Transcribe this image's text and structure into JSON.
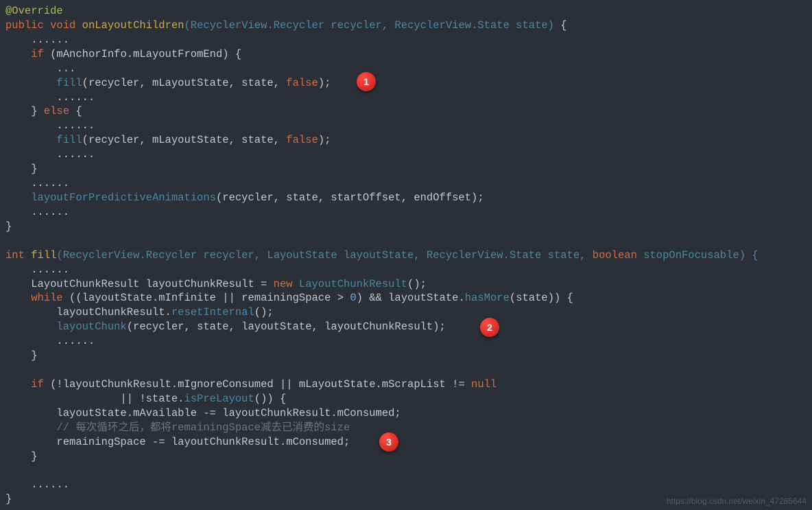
{
  "code": {
    "block1": {
      "l1_annotation": "@Override",
      "l2_kw_public": "public",
      "l2_kw_void": "void",
      "l2_method": "onLayoutChildren",
      "l2_sig_a": "(RecyclerView.Recycler recycler, RecyclerView.State state)",
      "l2_brace": " {",
      "l3_dots": "    ......",
      "l4_if_kw": "if",
      "l4_if_cond": " (mAnchorInfo.mLayoutFromEnd) {",
      "l5_dots": "        ...",
      "l6_indent": "        ",
      "l6_call": "fill",
      "l6_args_a": "(recycler, mLayoutState, state, ",
      "l6_false": "false",
      "l6_args_b": ");",
      "l7_dots": "        ......",
      "l8_else_a": "    } ",
      "l8_else_kw": "else",
      "l8_else_b": " {",
      "l9_dots": "        ......",
      "l10_indent": "        ",
      "l10_call": "fill",
      "l10_args_a": "(recycler, mLayoutState, state, ",
      "l10_false": "false",
      "l10_args_b": ");",
      "l11_dots": "        ......",
      "l12_close": "    }",
      "l13_dots": "    ......",
      "l14_indent": "    ",
      "l14_call": "layoutForPredictiveAnimations",
      "l14_args": "(recycler, state, startOffset, endOffset);",
      "l15_dots": "    ......",
      "l16_close": "}"
    },
    "block2": {
      "l1_kw_int": "int",
      "l1_method": "fill",
      "l1_sig_a": "(RecyclerView.Recycler recycler, LayoutState layoutState, RecyclerView.State state, ",
      "l1_bool": "boolean",
      "l1_sig_b": " stopOnFocusable) {",
      "l2_dots": "    ......",
      "l3_a": "    LayoutChunkResult layoutChunkResult = ",
      "l3_new": "new",
      "l3_b": " ",
      "l3_ctor": "LayoutChunkResult",
      "l3_c": "();",
      "l4_indent": "    ",
      "l4_while": "while",
      "l4_cond_a": " ((layoutState.mInfinite || remainingSpace > ",
      "l4_zero": "0",
      "l4_cond_b": ") && layoutState.",
      "l4_hasMore": "hasMore",
      "l4_cond_c": "(state)) {",
      "l5_a": "        layoutChunkResult.",
      "l5_reset": "resetInternal",
      "l5_b": "();",
      "l6_indent": "        ",
      "l6_call": "layoutChunk",
      "l6_args": "(recycler, state, layoutState, layoutChunkResult);",
      "l7_dots": "        ......",
      "l8_close": "    }",
      "l9_blank": "",
      "l10_indent": "    ",
      "l10_if": "if",
      "l10_cond_a": " (!layoutChunkResult.mIgnoreConsumed || mLayoutState.mScrapList != ",
      "l10_null": "null",
      "l11_cond_b": "                  || !state.",
      "l11_isPre": "isPreLayout",
      "l11_cond_c": "()) {",
      "l12": "        layoutState.mAvailable -= layoutChunkResult.mConsumed;",
      "l13_comment": "        // 每次循环之后，都将remainingSpace减去已消费的size",
      "l14": "        remainingSpace -= layoutChunkResult.mConsumed;",
      "l15_close": "    }",
      "l16_blank": "",
      "l17_dots": "    ......",
      "l18_close": "}"
    }
  },
  "badges": {
    "b1": "1",
    "b2": "2",
    "b3": "3"
  },
  "watermark": "https://blog.csdn.net/weixin_47285644"
}
